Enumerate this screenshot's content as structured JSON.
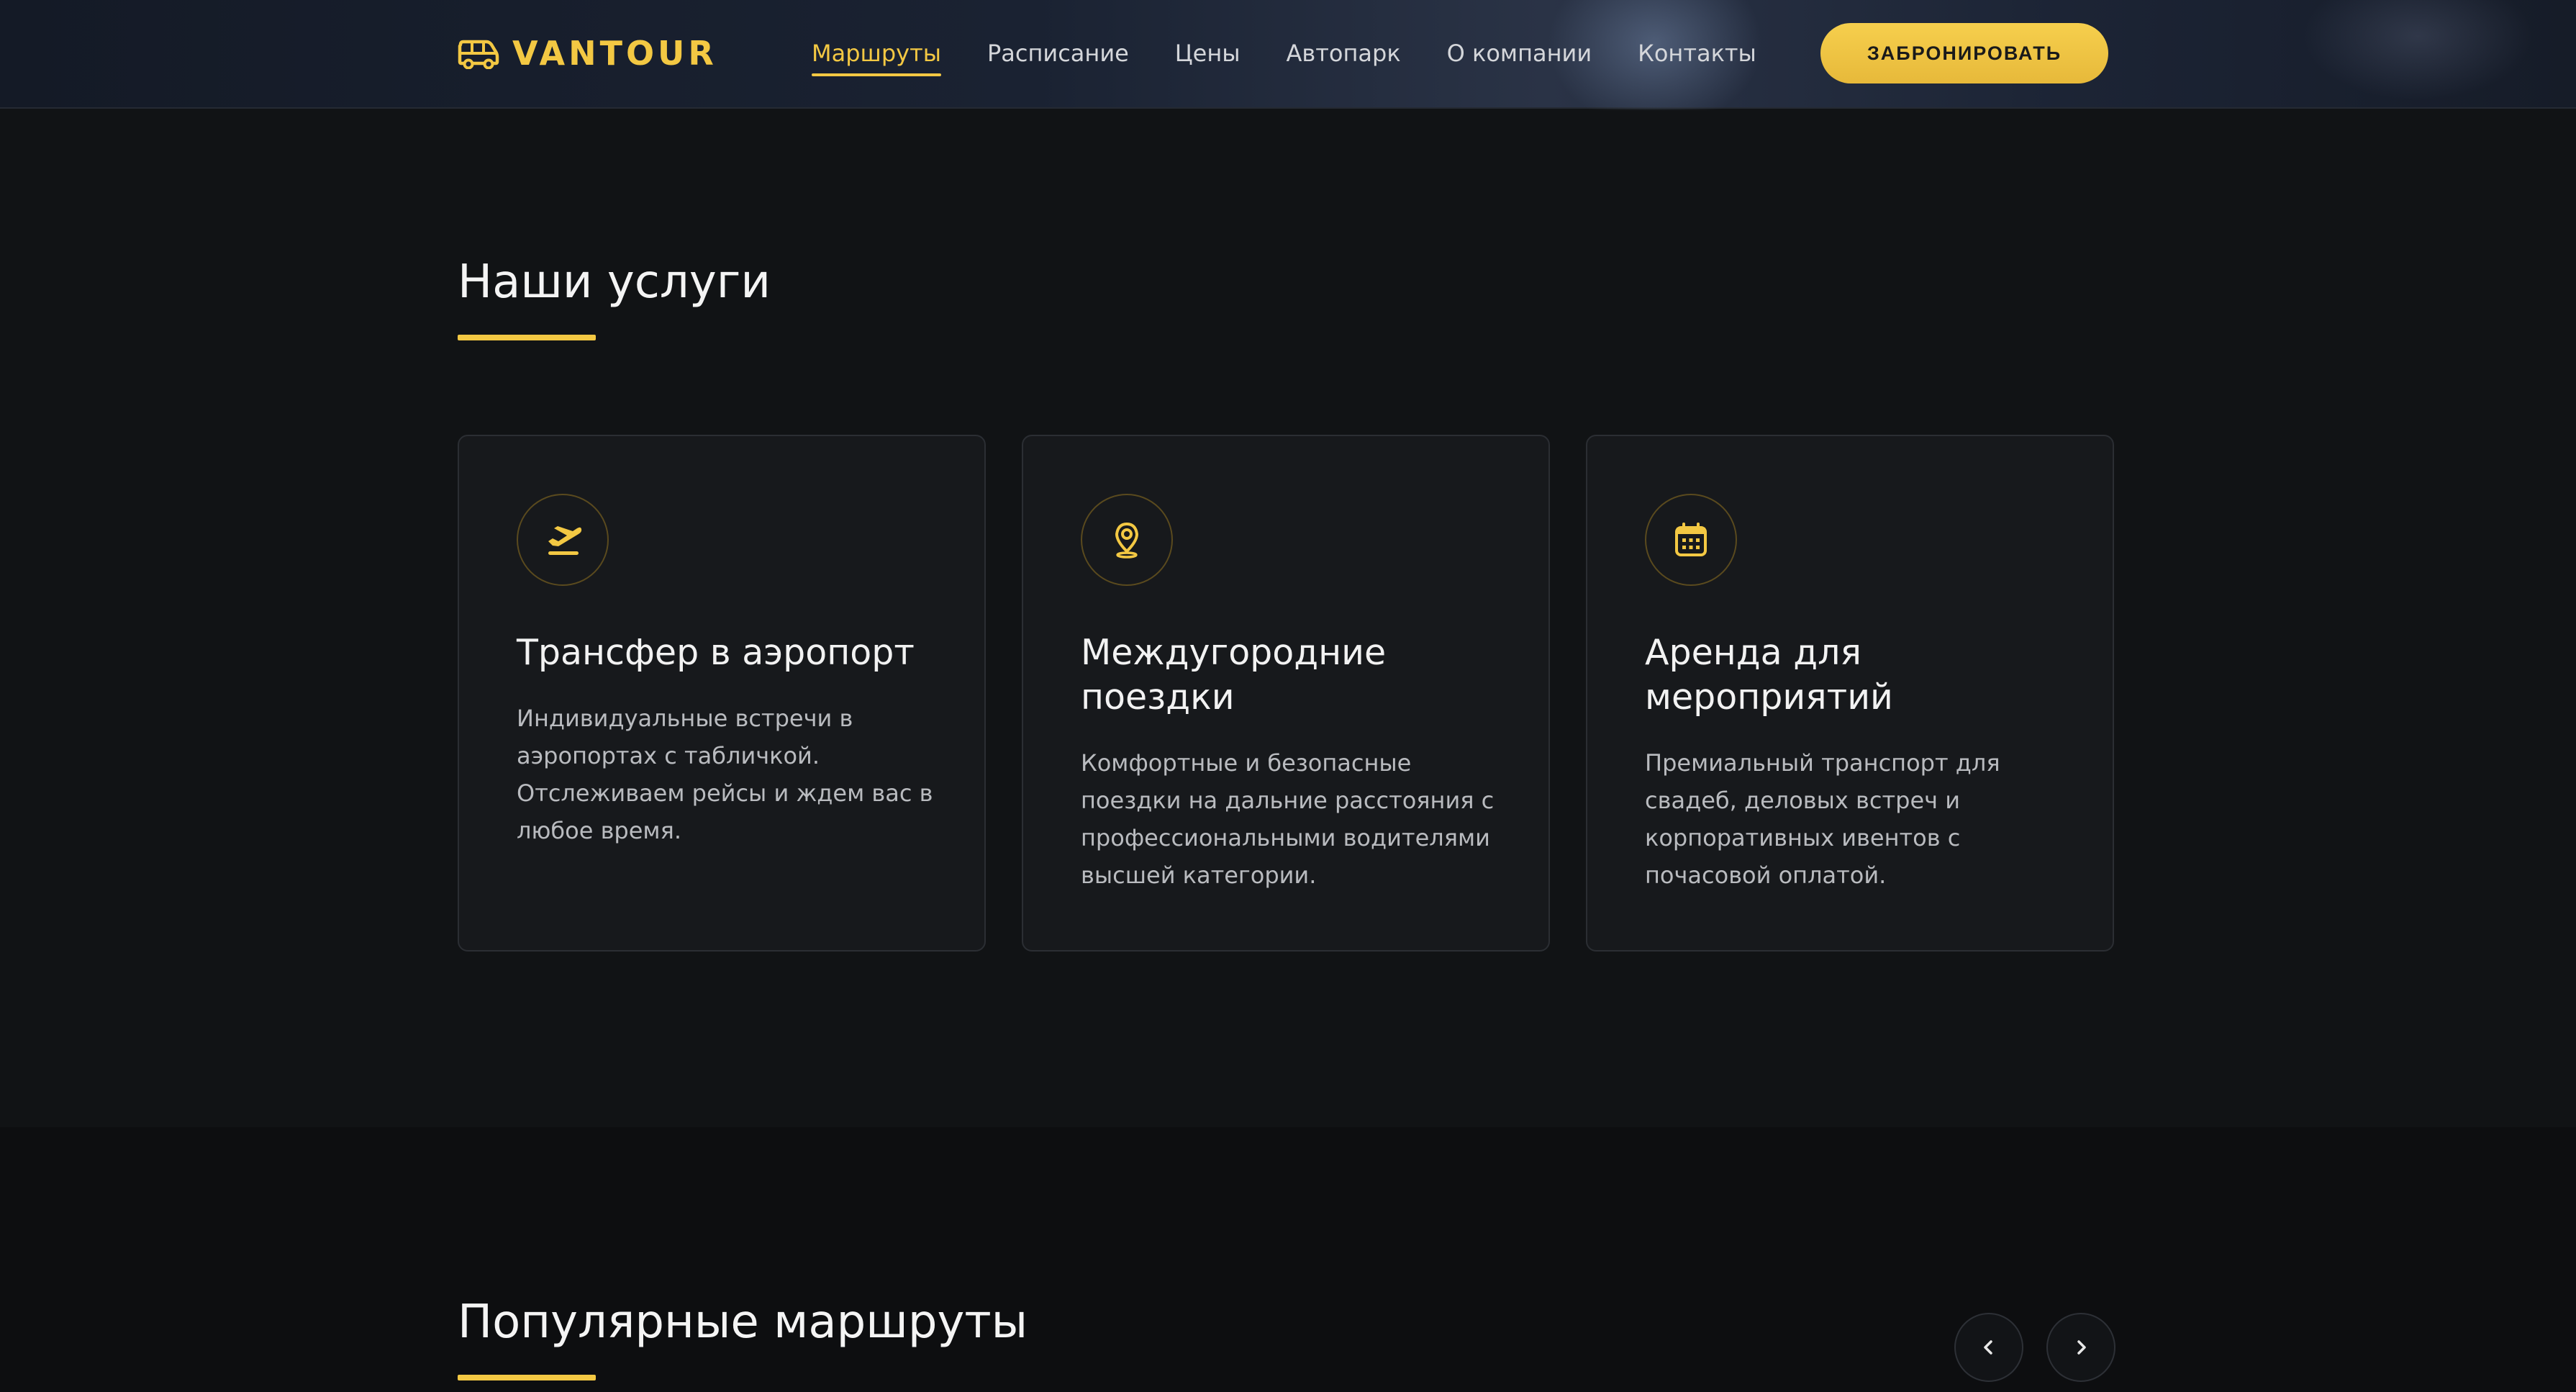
{
  "brand": {
    "name": "VANTOUR",
    "icon": "van-icon"
  },
  "nav": [
    {
      "label": "Маршруты",
      "active": true
    },
    {
      "label": "Расписание",
      "active": false
    },
    {
      "label": "Цены",
      "active": false
    },
    {
      "label": "Автопарк",
      "active": false
    },
    {
      "label": "О компании",
      "active": false
    },
    {
      "label": "Контакты",
      "active": false
    }
  ],
  "header": {
    "book_label": "ЗАБРОНИРОВАТЬ"
  },
  "services": {
    "title": "Наши услуги",
    "cards": [
      {
        "icon": "airplane-departure-icon",
        "title": "Трансфер в аэропорт",
        "description": "Индивидуальные встречи в аэропортах с табличкой. Отслеживаем рейсы и ждем вас в любое время."
      },
      {
        "icon": "map-pin-icon",
        "title": "Междугородние поездки",
        "description": "Комфортные и безопасные поездки на дальние расстояния с профессиональными водителями высшей категории."
      },
      {
        "icon": "calendar-icon",
        "title": "Аренда для мероприятий",
        "description": "Премиальный транспорт для свадеб, деловых встреч и корпоративных ивентов с почасовой оплатой."
      }
    ]
  },
  "routes": {
    "title": "Популярные маршруты",
    "prev_icon": "chevron-left-icon",
    "next_icon": "chevron-right-icon"
  },
  "colors": {
    "accent": "#f3c843",
    "background": "#111315",
    "card": "#17191c",
    "card_border": "#2b2e33",
    "text_muted": "#b9bbbf"
  }
}
